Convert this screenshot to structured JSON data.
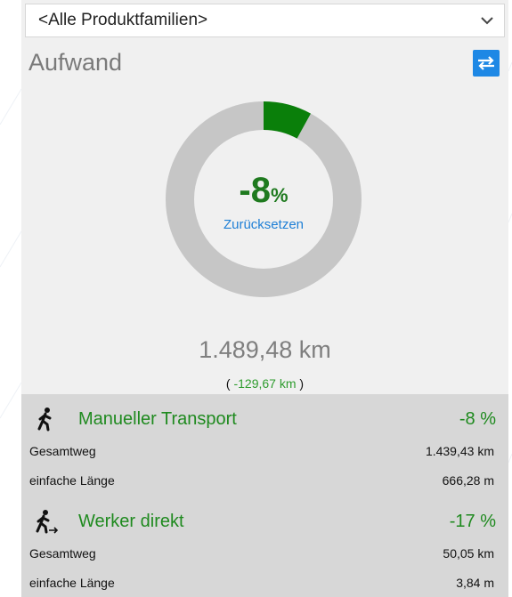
{
  "dropdown": {
    "value": "<Alle Produktfamilien>",
    "icon": "chevron-down-icon"
  },
  "header": {
    "title": "Aufwand",
    "swap_icon": "swap-arrows-icon"
  },
  "gauge": {
    "percent_value": "-8",
    "percent_unit": "%",
    "fraction": 0.08,
    "reset_label": "Zurücksetzen",
    "colors": {
      "fill": "#0a7f0a",
      "track": "#c6c6c6"
    }
  },
  "totals": {
    "distance": "1.489,48 km",
    "delta_open": "(",
    "delta_value": "-129,67 km",
    "delta_close": ")"
  },
  "sections": [
    {
      "name": "Manueller Transport",
      "percent": "-8 %",
      "icon": "walking-person-icon",
      "rows": [
        {
          "label": "Gesamtweg",
          "value": "1.439,43 km"
        },
        {
          "label": "einfache Länge",
          "value": "666,28 m"
        }
      ]
    },
    {
      "name": "Werker direkt",
      "percent": "-17 %",
      "icon": "walking-worker-arrow-icon",
      "rows": [
        {
          "label": "Gesamtweg",
          "value": "50,05 km"
        },
        {
          "label": "einfache Länge",
          "value": "3,84 m"
        }
      ]
    }
  ]
}
